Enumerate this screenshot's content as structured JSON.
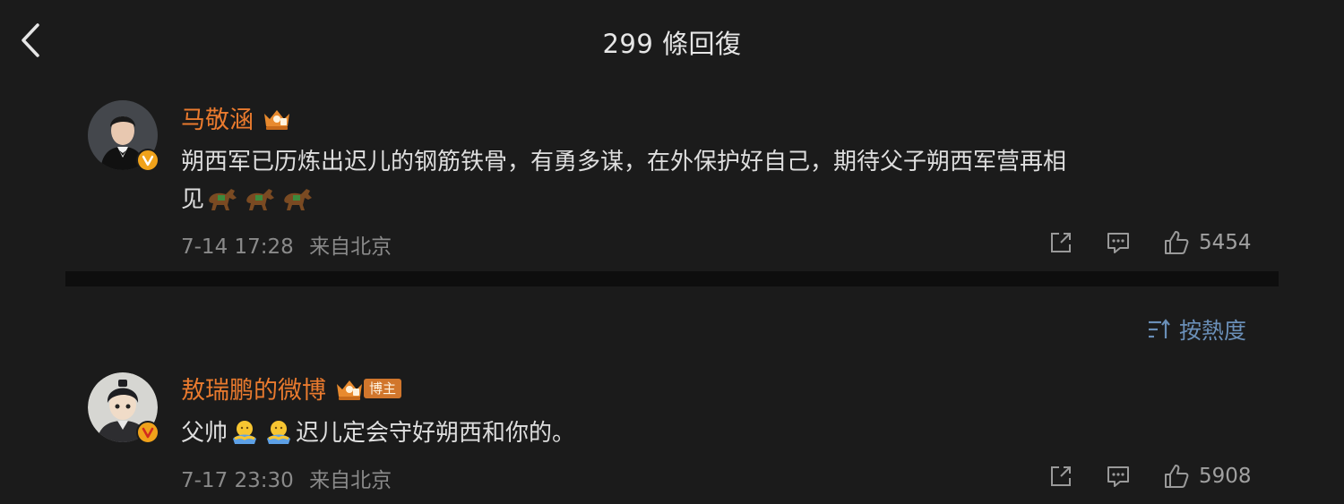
{
  "header": {
    "title": "299 條回復"
  },
  "main_comment": {
    "username": "马敬涵",
    "text_line1": "朔西军已历炼出迟儿的钢筋铁骨，有勇多谋，在外保护好自己，期待父子朔西军营再相",
    "text_line2": "见",
    "emoji_icons": [
      "horse-emoji",
      "horse-emoji",
      "horse-emoji"
    ],
    "date": "7-14 17:28",
    "location": "来自北京",
    "like_count": "5454"
  },
  "sort": {
    "label": "按熱度"
  },
  "reply": {
    "username": "敖瑞鹏的微博",
    "owner_tag": "博主",
    "text_part1": "父帅",
    "text_part2": "迟儿定会守好朔西和你的。",
    "emoji_icons": [
      "hug-emoji",
      "hug-emoji"
    ],
    "date": "7-17 23:30",
    "location": "来自北京",
    "like_count": "5908"
  },
  "colors": {
    "background": "#1b1b1b",
    "username": "#e97a2e",
    "text": "#dedede",
    "meta": "#8a8a8a",
    "accent_blue": "#6a8fb8",
    "verified_badge": "#f0a21a"
  }
}
